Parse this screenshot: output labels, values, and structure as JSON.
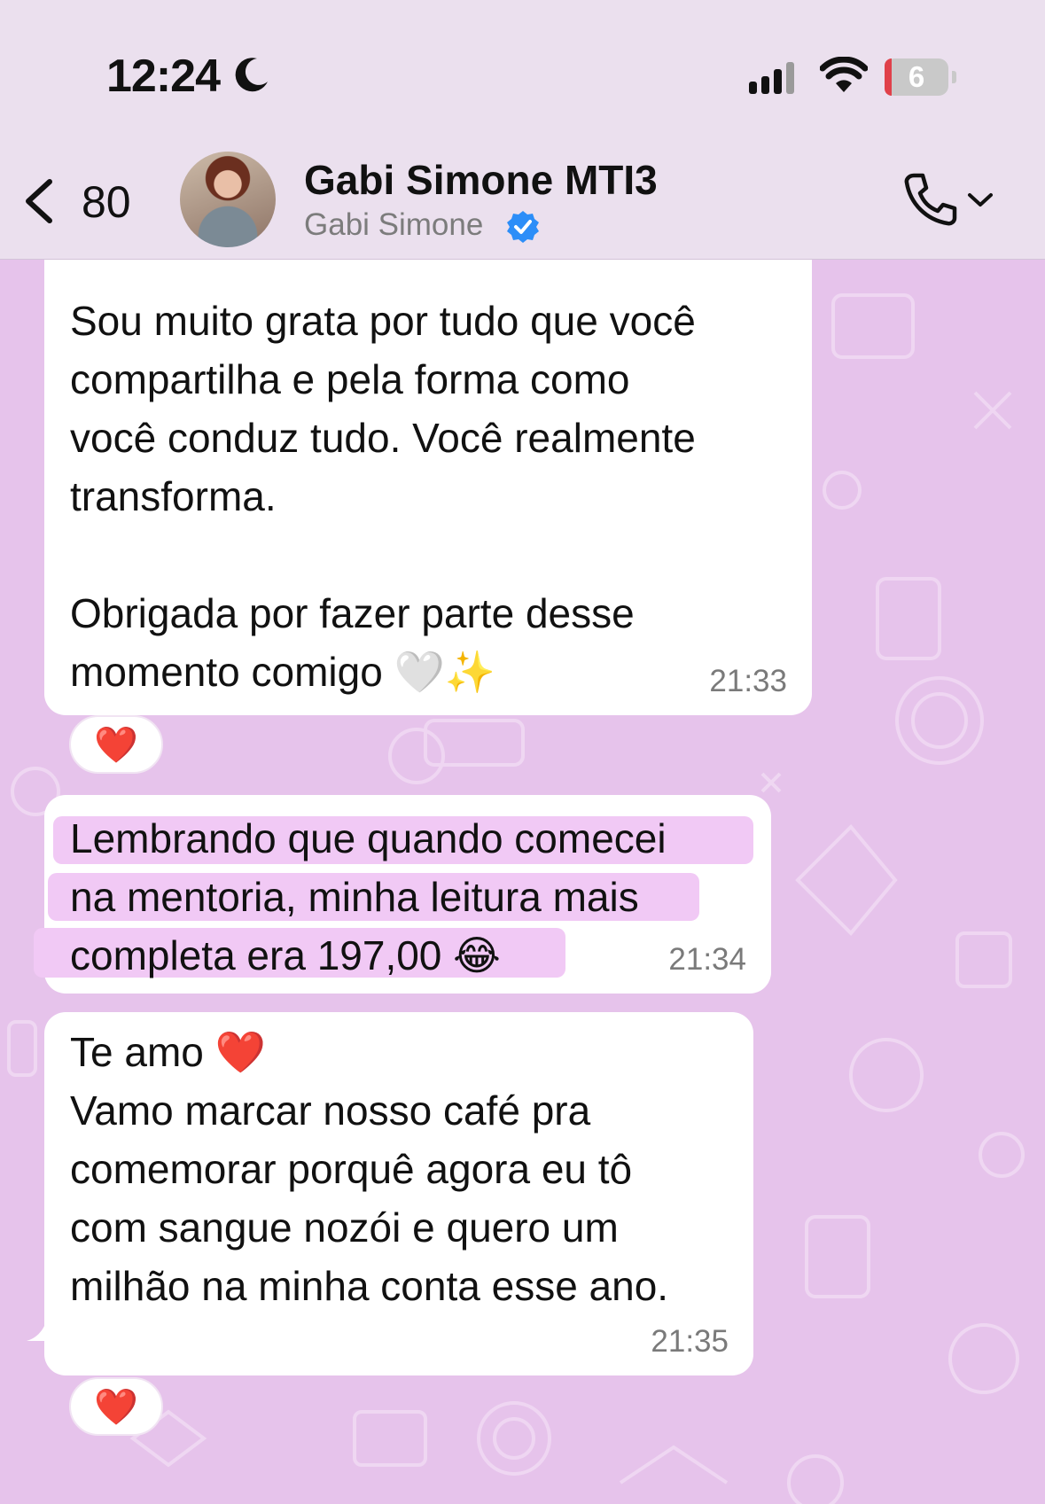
{
  "status_bar": {
    "time": "12:24",
    "battery": "6"
  },
  "header": {
    "back_count": "80",
    "contact_name": "Gabi Simone MTI3",
    "contact_subtitle": "Gabi Simone"
  },
  "messages": [
    {
      "lines": [
        "Sou muito grata por tudo que você",
        "compartilha e pela forma como",
        "você conduz tudo. Você realmente",
        "transforma.",
        "",
        "Obrigada por fazer parte desse",
        "momento comigo"
      ],
      "emojis": [
        "🤍",
        "✨"
      ],
      "time": "21:33",
      "reaction": "❤️"
    },
    {
      "lines": [
        "Lembrando que quando comecei",
        "na mentoria, minha leitura mais",
        "completa era 197,00"
      ],
      "emojis": [
        "😂"
      ],
      "time": "21:34"
    },
    {
      "lines": [
        "Te amo",
        "Vamo marcar nosso café pra",
        "comemorar porquê agora eu tô",
        "com sangue nozói e quero um",
        "milhão na minha conta esse ano."
      ],
      "emojis": [
        "❤️"
      ],
      "time": "21:35",
      "reaction": "❤️"
    }
  ],
  "colors": {
    "wallpaper": "#e6c3eb",
    "header_bg": "#ebe0ee",
    "bubble_bg": "#ffffff",
    "highlight": "#f1c9f5",
    "verified": "#2c8ef8",
    "heart": "#e21b2a"
  },
  "icons": [
    "moon-icon",
    "signal-icon",
    "wifi-icon",
    "battery-icon",
    "back-chevron-icon",
    "verified-badge-icon",
    "phone-icon",
    "chevron-down-icon"
  ]
}
